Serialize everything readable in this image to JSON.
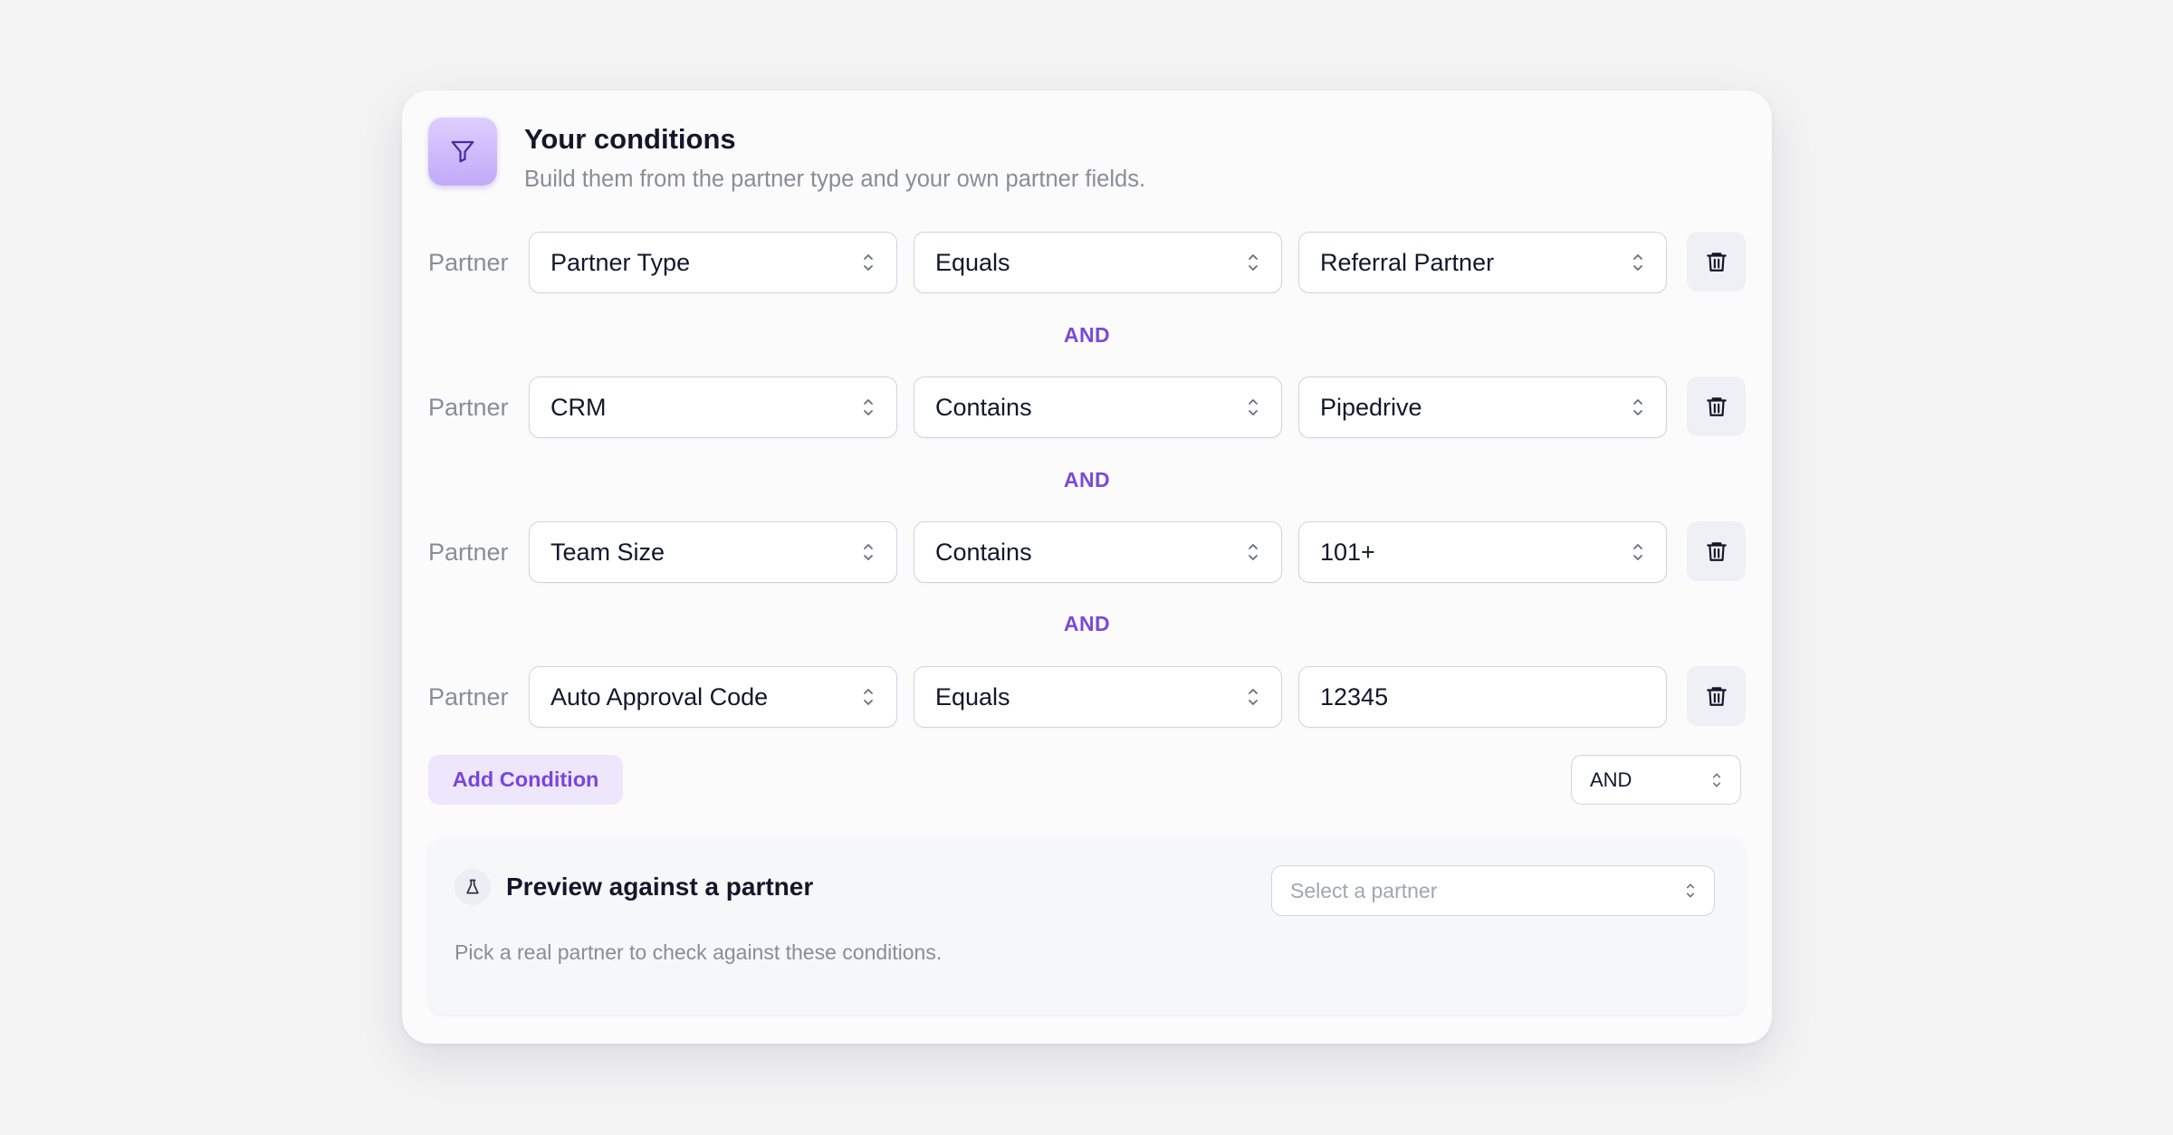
{
  "header": {
    "icon": "filter-icon",
    "title": "Your conditions",
    "subtitle": "Build them from the partner type and your own partner fields."
  },
  "conditions": [
    {
      "scope": "Partner",
      "field": "Partner Type",
      "operator": "Equals",
      "value": "Referral Partner",
      "value_type": "select"
    },
    {
      "scope": "Partner",
      "field": "CRM",
      "operator": "Contains",
      "value": "Pipedrive",
      "value_type": "select"
    },
    {
      "scope": "Partner",
      "field": "Team Size",
      "operator": "Contains",
      "value": "101+",
      "value_type": "select"
    },
    {
      "scope": "Partner",
      "field": "Auto Approval Code",
      "operator": "Equals",
      "value": "12345",
      "value_type": "text"
    }
  ],
  "connectors": [
    "AND",
    "AND",
    "AND"
  ],
  "actions": {
    "add_condition_label": "Add Condition",
    "logic_operator": "AND",
    "delete_icon": "trash-icon"
  },
  "preview": {
    "icon": "flask-icon",
    "title": "Preview against a partner",
    "select_placeholder": "Select a partner",
    "help_text": "Pick a real partner to check against these conditions."
  },
  "colors": {
    "accent": "#7b49d9",
    "accent_soft": "#ede6fd",
    "icon_gradient_top": "#ddcffd",
    "icon_gradient_bottom": "#c2aaf9",
    "page_background": "#f3f3f4",
    "card_background": "#fbfbfc"
  }
}
